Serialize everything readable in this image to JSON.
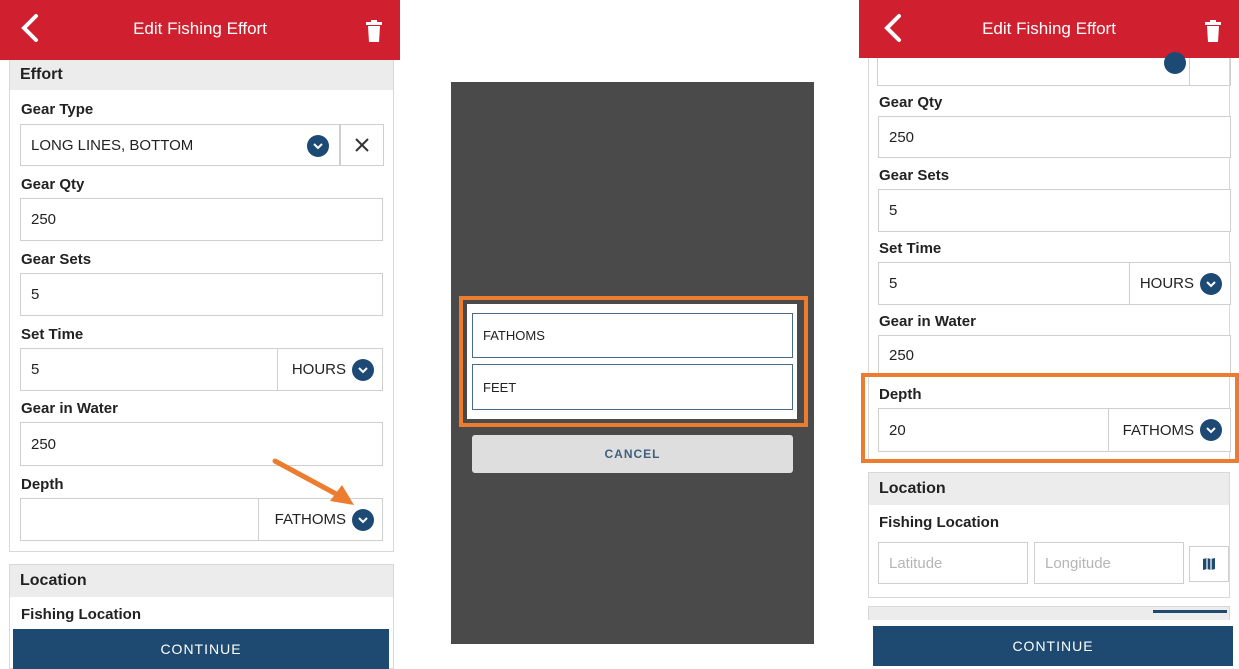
{
  "colors": {
    "header": "#d0202f",
    "primary": "#1e4a71",
    "highlight": "#ec7d30",
    "overlay": "#4a4a4a"
  },
  "left": {
    "header_title": "Edit Fishing Effort",
    "section_effort": "Effort",
    "gear_type_label": "Gear Type",
    "gear_type_value": "LONG LINES, BOTTOM",
    "gear_qty_label": "Gear Qty",
    "gear_qty_value": "250",
    "gear_sets_label": "Gear Sets",
    "gear_sets_value": "5",
    "set_time_label": "Set Time",
    "set_time_value": "5",
    "set_time_unit": "HOURS",
    "gear_in_water_label": "Gear in Water",
    "gear_in_water_value": "250",
    "depth_label": "Depth",
    "depth_value": "",
    "depth_unit": "FATHOMS",
    "section_location": "Location",
    "fishing_location_label": "Fishing Location",
    "continue_label": "CONTINUE"
  },
  "middle": {
    "options": [
      "FATHOMS",
      "FEET"
    ],
    "cancel_label": "CANCEL"
  },
  "right": {
    "header_title": "Edit Fishing Effort",
    "gear_qty_label": "Gear Qty",
    "gear_qty_value": "250",
    "gear_sets_label": "Gear Sets",
    "gear_sets_value": "5",
    "set_time_label": "Set Time",
    "set_time_value": "5",
    "set_time_unit": "HOURS",
    "gear_in_water_label": "Gear in Water",
    "gear_in_water_value": "250",
    "depth_label": "Depth",
    "depth_value": "20",
    "depth_unit": "FATHOMS",
    "section_location": "Location",
    "fishing_location_label": "Fishing Location",
    "latitude_placeholder": "Latitude",
    "longitude_placeholder": "Longitude",
    "continue_label": "CONTINUE"
  },
  "icons": {
    "back": "chevron-left-icon",
    "delete": "trash-icon",
    "dropdown": "chevron-down-icon",
    "clear": "close-icon",
    "map": "map-icon"
  }
}
